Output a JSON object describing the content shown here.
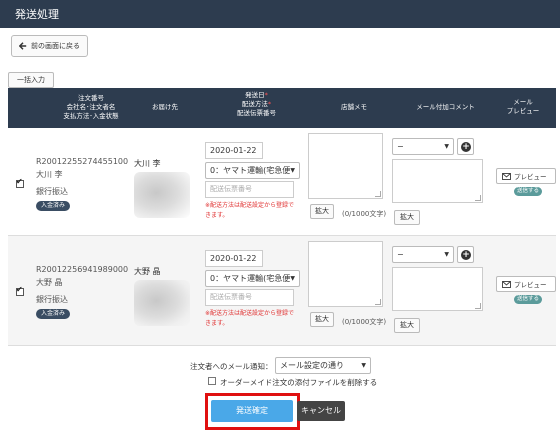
{
  "window": {
    "title": "発送処理"
  },
  "toolbar": {
    "back_label": "前の画面に戻る",
    "bulk_label": "一括入力"
  },
  "table": {
    "headers": {
      "order_line1": "注文番号",
      "order_line2": "会社名･注文者名",
      "order_line3": "支払方法･入金状態",
      "destination": "お届け先",
      "ship_line1": "発送日",
      "ship_line2": "配送方法",
      "ship_line3": "配送伝票番号",
      "memo": "店舗メモ",
      "comment": "メール付加コメント",
      "preview_line1": "メール",
      "preview_line2": "プレビュー",
      "required_mark": "*"
    },
    "rows": [
      {
        "order_number": "R20012255274455100",
        "customer_name": "大川 李",
        "payment_method": "銀行振込",
        "payment_status": "入金済み",
        "destination_name": "大川 李",
        "ship_date": "2020-01-22",
        "shipping_method": "0：ヤマト運輸(宅急便",
        "tracking_placeholder": "配送伝票番号",
        "shipping_note": "※配送方法は配送設定から登録できます。",
        "expand_label": "拡大",
        "memo_count": "(0/1000文字)",
        "comment_select": "−",
        "comment_expand_label": "拡大",
        "preview_label": "プレビュー",
        "sent_badge": "送信する"
      },
      {
        "order_number": "R20012256941989000",
        "customer_name": "大野 晶",
        "payment_method": "銀行振込",
        "payment_status": "入金済み",
        "destination_name": "大野 晶",
        "ship_date": "2020-01-22",
        "shipping_method": "0：ヤマト運輸(宅急便",
        "tracking_placeholder": "配送伝票番号",
        "shipping_note": "※配送方法は配送設定から登録できます。",
        "expand_label": "拡大",
        "memo_count": "(0/1000文字)",
        "comment_select": "−",
        "comment_expand_label": "拡大",
        "preview_label": "プレビュー",
        "sent_badge": "送信する"
      }
    ]
  },
  "footer": {
    "notify_label": "注文者へのメール通知：",
    "notify_value": "メール設定の通り",
    "delete_attachment_label": "オーダーメイド注文の添付ファイルを削除する",
    "confirm_label": "発送確定",
    "cancel_label": "キャンセル"
  },
  "colors": {
    "header_bg": "#2d3c4f",
    "accent": "#4aa8e8",
    "highlight": "#e01010",
    "badge": "#5b9b9b"
  }
}
